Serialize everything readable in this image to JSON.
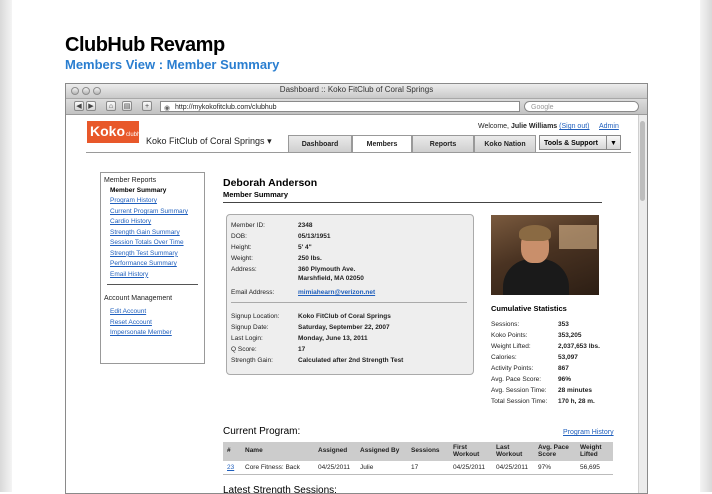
{
  "document": {
    "title": "ClubHub Revamp",
    "subtitle": "Members View : Member Summary"
  },
  "browser": {
    "window_title": "Dashboard :: Koko FitClub of Coral Springs",
    "url": "http://mykokofitclub.com/clubhub",
    "search_placeholder": "Google"
  },
  "header": {
    "logo_text": "Koko",
    "logo_sub": "clubhub",
    "club_name": "Koko FitClub of Coral Springs",
    "welcome_prefix": "Welcome,",
    "user_name": "Julie Williams",
    "sign_out": "(Sign out)",
    "admin": "Admin",
    "tools_label": "Tools & Support"
  },
  "tabs": [
    {
      "label": "Dashboard",
      "active": false
    },
    {
      "label": "Members",
      "active": true
    },
    {
      "label": "Reports",
      "active": false
    },
    {
      "label": "Koko Nation",
      "active": false
    }
  ],
  "sidebar": {
    "reports_heading": "Member Reports",
    "reports": [
      {
        "label": "Member Summary",
        "current": true
      },
      {
        "label": "Program History",
        "current": false
      },
      {
        "label": "Current Program Summary",
        "current": false
      },
      {
        "label": "Cardio History",
        "current": false
      },
      {
        "label": "Strength Gain Summary",
        "current": false
      },
      {
        "label": "Session Totals Over Time",
        "current": false
      },
      {
        "label": "Strength Test Summary",
        "current": false
      },
      {
        "label": "Performance Summary",
        "current": false
      },
      {
        "label": "Email History",
        "current": false
      }
    ],
    "account_heading": "Account Management",
    "account": [
      {
        "label": "Edit Account"
      },
      {
        "label": "Reset Account"
      },
      {
        "label": "Impersonate Member"
      }
    ]
  },
  "member": {
    "name": "Deborah Anderson",
    "section": "Member Summary",
    "fields": [
      {
        "label": "Member ID:",
        "value": "2348"
      },
      {
        "label": "DOB:",
        "value": "05/13/1951"
      },
      {
        "label": "Height:",
        "value": "5' 4\""
      },
      {
        "label": "Weight:",
        "value": "250 lbs."
      },
      {
        "label": "Address:",
        "value": "360 Plymouth Ave.",
        "value2": "Marshfield, MA 02050"
      },
      {
        "label": "Email Address:",
        "value": "mimiahearn@verizon.net"
      },
      {
        "label": "Signup Location:",
        "value": "Koko FitClub of Coral Springs"
      },
      {
        "label": "Signup Date:",
        "value": "Saturday, September 22, 2007"
      },
      {
        "label": "Last Login:",
        "value": "Monday, June 13, 2011"
      },
      {
        "label": "Q Score:",
        "value": "17"
      },
      {
        "label": "Strength Gain:",
        "value": "Calculated after 2nd Strength Test"
      }
    ]
  },
  "stats": {
    "title": "Cumulative Statistics",
    "items": [
      {
        "label": "Sessions:",
        "value": "353"
      },
      {
        "label": "Koko Points:",
        "value": "353,205"
      },
      {
        "label": "Weight Lifted:",
        "value": "2,037,653 lbs."
      },
      {
        "label": "Calories:",
        "value": "53,097"
      },
      {
        "label": "Activity Points:",
        "value": "867"
      },
      {
        "label": "Avg. Pace Score:",
        "value": "96%"
      },
      {
        "label": "Avg. Session Time:",
        "value": "28 minutes"
      },
      {
        "label": "Total Session Time:",
        "value": "170 h, 28 m."
      }
    ]
  },
  "current_program": {
    "title": "Current Program:",
    "history_link": "Program History",
    "columns": [
      "#",
      "Name",
      "Assigned",
      "Assigned By",
      "Sessions",
      "First Workout",
      "Last Workout",
      "Avg. Pace Score",
      "Weight Lifted"
    ],
    "rows": [
      [
        "23",
        "Core Fitness: Back",
        "04/25/2011",
        "Julie",
        "17",
        "04/25/2011",
        "04/25/2011",
        "97%",
        "56,695"
      ]
    ]
  },
  "next_section_title": "Latest Strength Sessions:"
}
